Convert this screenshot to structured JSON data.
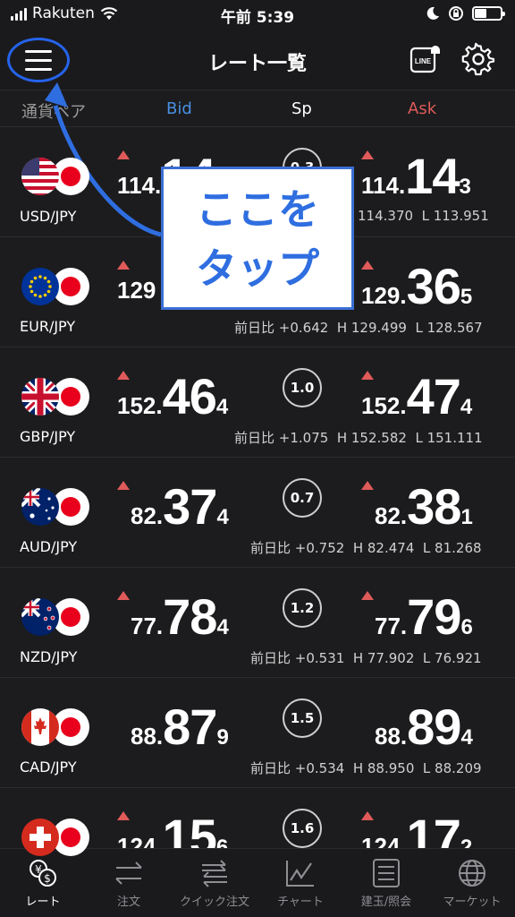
{
  "status_bar": {
    "carrier": "Rakuten",
    "time": "午前 5:39"
  },
  "header": {
    "title": "レート一覧",
    "line_badge": "LINE"
  },
  "columns": {
    "pair": "通貨ペア",
    "bid": "Bid",
    "spread": "Sp",
    "ask": "Ask"
  },
  "rows": [
    {
      "pair": "USD/JPY",
      "bid_1": "114.",
      "bid_2": "14",
      "bid_3": "",
      "spread": "0.3",
      "ask_1": "114.",
      "ask_2": "14",
      "ask_3": "3",
      "change": "",
      "high": "114.370",
      "low": "L 113.951"
    },
    {
      "pair": "EUR/JPY",
      "bid_1": "129",
      "bid_2": "",
      "bid_3": "",
      "spread": "",
      "ask_1": "129.",
      "ask_2": "36",
      "ask_3": "5",
      "change": "前日比 +0.642",
      "high": "H 129.499",
      "low": "L 128.567"
    },
    {
      "pair": "GBP/JPY",
      "bid_1": "152.",
      "bid_2": "46",
      "bid_3": "4",
      "spread": "1.0",
      "ask_1": "152.",
      "ask_2": "47",
      "ask_3": "4",
      "change": "前日比 +1.075",
      "high": "H 152.582",
      "low": "L 151.111"
    },
    {
      "pair": "AUD/JPY",
      "bid_1": "82.",
      "bid_2": "37",
      "bid_3": "4",
      "spread": "0.7",
      "ask_1": "82.",
      "ask_2": "38",
      "ask_3": "1",
      "change": "前日比 +0.752",
      "high": "H 82.474",
      "low": "L 81.268"
    },
    {
      "pair": "NZD/JPY",
      "bid_1": "77.",
      "bid_2": "78",
      "bid_3": "4",
      "spread": "1.2",
      "ask_1": "77.",
      "ask_2": "79",
      "ask_3": "6",
      "change": "前日比 +0.531",
      "high": "H 77.902",
      "low": "L 76.921"
    },
    {
      "pair": "CAD/JPY",
      "bid_1": "88.",
      "bid_2": "87",
      "bid_3": "9",
      "spread": "1.5",
      "ask_1": "88.",
      "ask_2": "89",
      "ask_3": "4",
      "change": "前日比 +0.534",
      "high": "H 88.950",
      "low": "L 88.209"
    },
    {
      "pair": "",
      "bid_1": "124.",
      "bid_2": "15",
      "bid_3": "6",
      "spread": "1.6",
      "ask_1": "124.",
      "ask_2": "17",
      "ask_3": "2",
      "change": "",
      "high": "",
      "low": ""
    }
  ],
  "annotation": {
    "line1": "ここを",
    "line2": "タップ"
  },
  "tabs": [
    {
      "label": "レート",
      "icon": "rate-icon",
      "active": true
    },
    {
      "label": "注文",
      "icon": "order-icon",
      "active": false
    },
    {
      "label": "クイック注文",
      "icon": "quick-order-icon",
      "active": false
    },
    {
      "label": "チャート",
      "icon": "chart-icon",
      "active": false
    },
    {
      "label": "建玉/照会",
      "icon": "positions-icon",
      "active": false
    },
    {
      "label": "マーケット",
      "icon": "market-icon",
      "active": false
    }
  ],
  "colors": {
    "background": "#1c1c1e",
    "bid": "#4a90e2",
    "ask": "#e05a5a",
    "highlight": "#2563eb",
    "up_arrow": "#e05a5a"
  }
}
